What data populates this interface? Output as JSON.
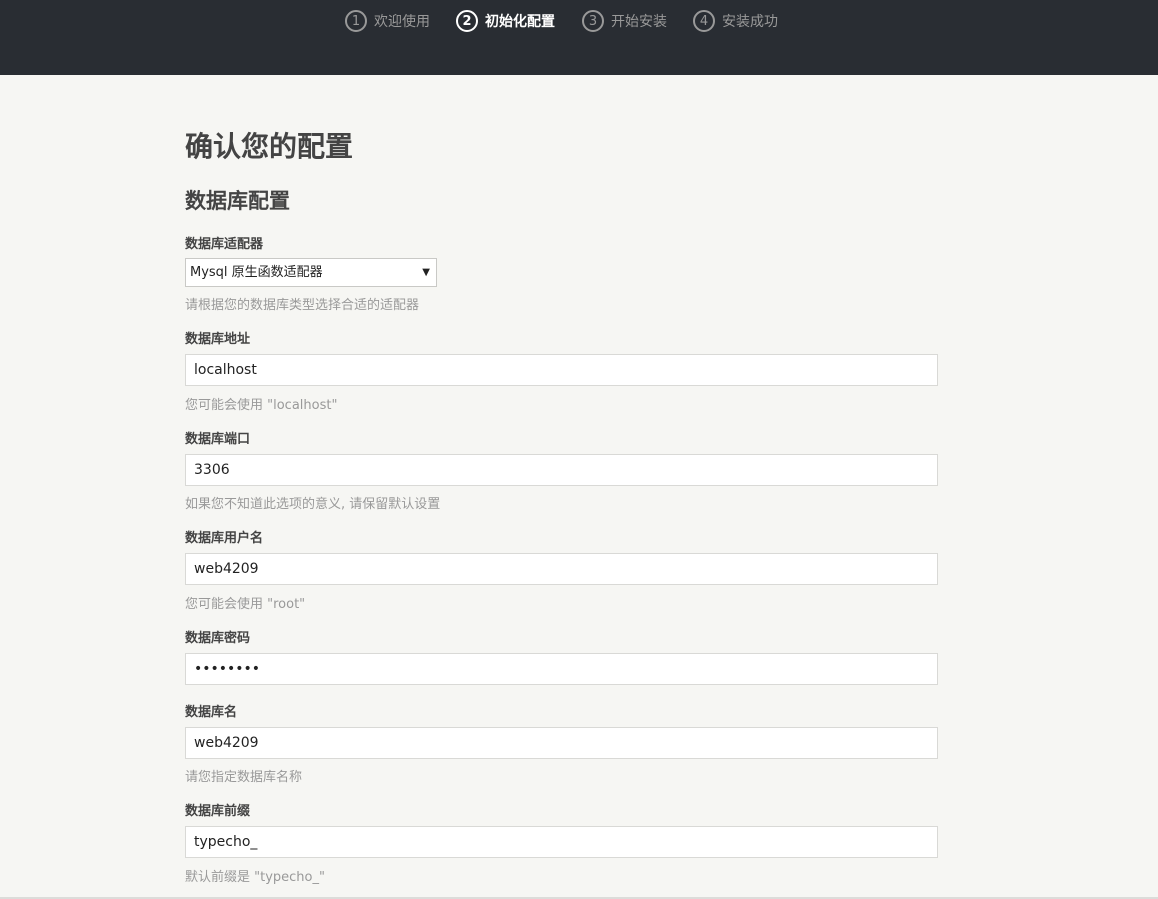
{
  "steps": [
    {
      "num": "1",
      "label": "欢迎使用"
    },
    {
      "num": "2",
      "label": "初始化配置"
    },
    {
      "num": "3",
      "label": "开始安装"
    },
    {
      "num": "4",
      "label": "安装成功"
    }
  ],
  "page_title": "确认您的配置",
  "section_title": "数据库配置",
  "fields": {
    "adapter": {
      "label": "数据库适配器",
      "value": "Mysql 原生函数适配器",
      "description": "请根据您的数据库类型选择合适的适配器"
    },
    "host": {
      "label": "数据库地址",
      "value": "localhost",
      "description": "您可能会使用 \"localhost\""
    },
    "port": {
      "label": "数据库端口",
      "value": "3306",
      "description": "如果您不知道此选项的意义, 请保留默认设置"
    },
    "user": {
      "label": "数据库用户名",
      "value": "web4209",
      "description": "您可能会使用 \"root\""
    },
    "password": {
      "label": "数据库密码",
      "value": "••••••••"
    },
    "dbname": {
      "label": "数据库名",
      "value": "web4209",
      "description": "请您指定数据库名称"
    },
    "prefix": {
      "label": "数据库前缀",
      "value": "typecho_",
      "description": "默认前缀是 \"typecho_\""
    }
  }
}
